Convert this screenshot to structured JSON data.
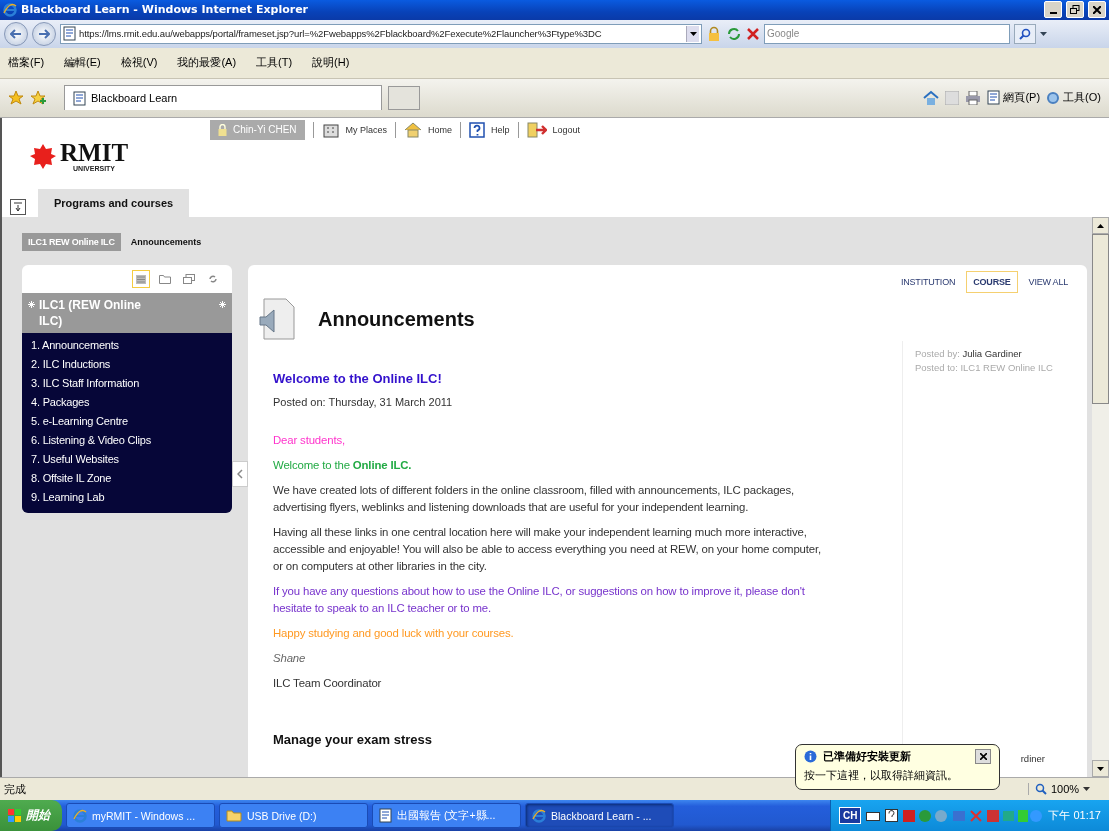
{
  "browser": {
    "title": "Blackboard Learn - Windows Internet Explorer",
    "address": "https://lms.rmit.edu.au/webapps/portal/frameset.jsp?url=%2Fwebapps%2Fblackboard%2Fexecute%2Flauncher%3Ftype%3DC",
    "search_placeholder": "Google",
    "menu": [
      "檔案(F)",
      "編輯(E)",
      "檢視(V)",
      "我的最愛(A)",
      "工具(T)",
      "說明(H)"
    ],
    "tab": "Blackboard Learn",
    "tools": [
      "網頁(P)",
      "工具(O)"
    ]
  },
  "header": {
    "user": "Chin-Yi CHEN",
    "nav": [
      {
        "kind": "places",
        "label": "My Places"
      },
      {
        "kind": "home",
        "label": "Home"
      },
      {
        "kind": "help",
        "label": "Help"
      },
      {
        "kind": "logout",
        "label": "Logout"
      }
    ],
    "logo": "RMIT",
    "logo_sub": "UNIVERSITY",
    "tabs": [
      {
        "label": "Programs and courses",
        "selected": true
      }
    ]
  },
  "breadcrumb": [
    "ILC1 REW Online ILC",
    "Announcements"
  ],
  "course_menu": {
    "views": [
      {
        "kind": "list",
        "selected": true
      },
      {
        "kind": "folder",
        "selected": false
      },
      {
        "kind": "window",
        "selected": false
      },
      {
        "kind": "refresh",
        "selected": false
      }
    ],
    "title": "ILC1 (REW Online ILC)",
    "items": [
      "1. Announcements",
      "2. ILC Inductions",
      "3. ILC Staff Information",
      "4. Packages",
      "5. e-Learning Centre",
      "6. Listening & Video Clips",
      "7. Useful Websites",
      "8. Offsite IL Zone",
      "9. Learning Lab"
    ]
  },
  "scope_tabs": [
    {
      "label": "INSTITUTION",
      "selected": false
    },
    {
      "label": "COURSE",
      "selected": true
    },
    {
      "label": "VIEW ALL",
      "selected": false
    }
  ],
  "heading": "Announcements",
  "posts": [
    {
      "title": "Welcome to the Online ILC!",
      "posted_on": "Posted on: Thursday, 31 March 2011",
      "paragraphs": [
        {
          "kind": "text",
          "color": "#ff33cc",
          "text": "Dear students,"
        },
        {
          "kind": "text",
          "color": "#22aa44",
          "text": "Welcome to the **Online ILC.**"
        },
        {
          "kind": "text",
          "color": "#333333",
          "text": "We have created lots of different folders in the online classroom, filled with announcements, ILC packages, advertising flyers, weblinks and listening downloads that are useful for your independent learning."
        },
        {
          "kind": "text",
          "color": "#333333",
          "text": "Having all these links in one central location here will make your independent learning much more interactive, accessible and enjoyable! You will also be able to access everything you need at REW, on your home computer, or on computers at other libraries in the city."
        },
        {
          "kind": "text",
          "color": "#7733cc",
          "text": "If you have any questions about how to use the Online ILC, or suggestions on how to improve it, please don't hesitate to speak to an ILC teacher or to me."
        },
        {
          "kind": "text",
          "color": "#ff9922",
          "text": "Happy studying and good luck with your courses."
        },
        {
          "kind": "signature",
          "color": "#666666",
          "text": "Shane"
        },
        {
          "kind": "text",
          "color": "#333333",
          "text": "ILC Team Coordinator"
        }
      ],
      "posted_by_label": "Posted by:",
      "posted_by": "Julia Gardiner",
      "posted_to": "Posted to: ILC1 REW Online ILC"
    },
    {
      "title": "Manage your exam stress",
      "posted_by": "rdiner"
    }
  ],
  "status_bar": {
    "text": "完成",
    "zoom": "100%"
  },
  "taskbar": {
    "start": "開始",
    "tasks": [
      {
        "kind": "browser",
        "label": "myRMIT - Windows ...",
        "selected": false
      },
      {
        "kind": "folder",
        "label": "USB Drive (D:)",
        "selected": false
      },
      {
        "kind": "document",
        "label": "出國報告 (文字+縣...",
        "selected": false
      },
      {
        "kind": "browser",
        "label": "Blackboard Learn - ...",
        "selected": true
      }
    ],
    "lang": "CH",
    "clock": "下午 01:17"
  },
  "balloon": {
    "title": "已準備好安裝更新",
    "text": "按一下這裡，以取得詳細資訊。"
  }
}
